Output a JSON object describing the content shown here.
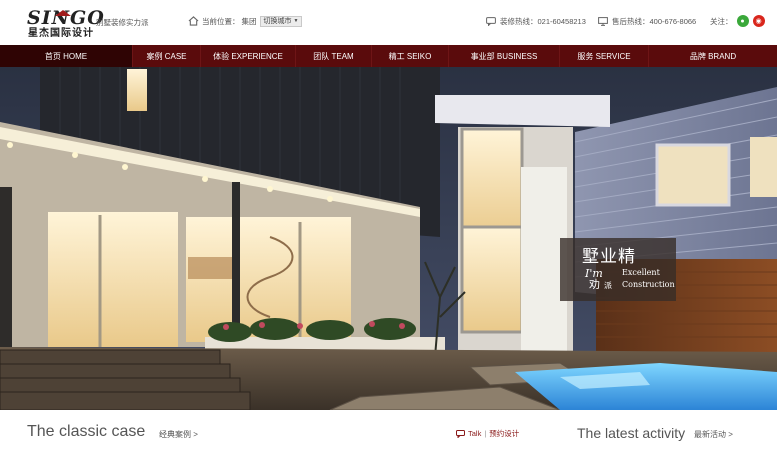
{
  "brand": {
    "logo_text": "SINGO",
    "logo_cn": "星杰国际设计",
    "slogan": "别墅装修实力派"
  },
  "location": {
    "icon": "home-icon",
    "label": "当前位置：",
    "value": "集团",
    "city_select": "切换城市"
  },
  "contacts": {
    "hotline1_label": "装修热线：021-60458213",
    "hotline2_label": "售后热线：400-676-8066",
    "follow_label": "关注：",
    "social": [
      {
        "name": "wechat",
        "icon": "wechat-icon",
        "color": "#3aa83a"
      },
      {
        "name": "weibo",
        "icon": "weibo-icon",
        "color": "#d9261c"
      }
    ]
  },
  "nav": {
    "items": [
      {
        "label": "首页 HOME",
        "active": true
      },
      {
        "label": "案例 CASE"
      },
      {
        "label": "体验 EXPERIENCE"
      },
      {
        "label": "团队 TEAM"
      },
      {
        "label": "精工 SEIKO"
      },
      {
        "label": "事业部 BUSINESS"
      },
      {
        "label": "服务 SERVICE"
      },
      {
        "label": "品牌 BRAND"
      }
    ]
  },
  "hero": {
    "badge_title": "墅业精",
    "badge_mark_top": "I'm",
    "badge_mark_bottom": "劝",
    "badge_pai": "派",
    "badge_en_line1": "Excellent",
    "badge_en_line2": "Construction"
  },
  "sections": {
    "classic_title": "The classic case",
    "classic_more": "经典案例 >",
    "talk_label": "Talk",
    "appointment_label": "预约设计",
    "activity_title": "The latest activity",
    "activity_more": "最新活动 >"
  },
  "colors": {
    "nav_bg": "#5a0b0c",
    "nav_active": "#2f0404",
    "accent": "#8a1a1a"
  }
}
